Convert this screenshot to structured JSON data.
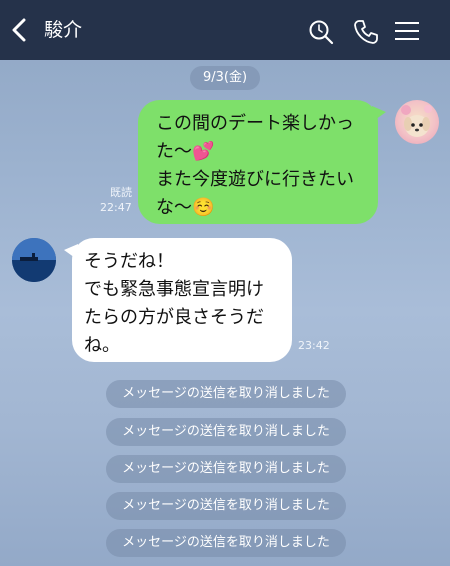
{
  "header": {
    "title": "駿介",
    "icons": [
      "back-icon",
      "search-icon",
      "call-icon",
      "menu-icon"
    ]
  },
  "date_divider": "9/3(金)",
  "messages": [
    {
      "sender": "me",
      "lines": [
        "この間のデート楽しかっ",
        "た〜💕",
        "また今度遊びに行きたい",
        "な〜☺️"
      ],
      "read_label": "既読",
      "time": "22:47",
      "bubble_color": "#7ee06a"
    },
    {
      "sender": "other",
      "lines": [
        "そうだね！",
        "でも緊急事態宣言明け",
        "たらの方が良さそうだ",
        "ね。"
      ],
      "time": "23:42",
      "bubble_color": "#ffffff"
    }
  ],
  "unsent_notices": [
    "メッセージの送信を取り消しました",
    "メッセージの送信を取り消しました",
    "メッセージの送信を取り消しました",
    "メッセージの送信を取り消しました",
    "メッセージの送信を取り消しました"
  ],
  "colors": {
    "header_bg": "#25324a",
    "chat_bg": "#9cb2cf",
    "pill_bg": "#7f93b0"
  }
}
